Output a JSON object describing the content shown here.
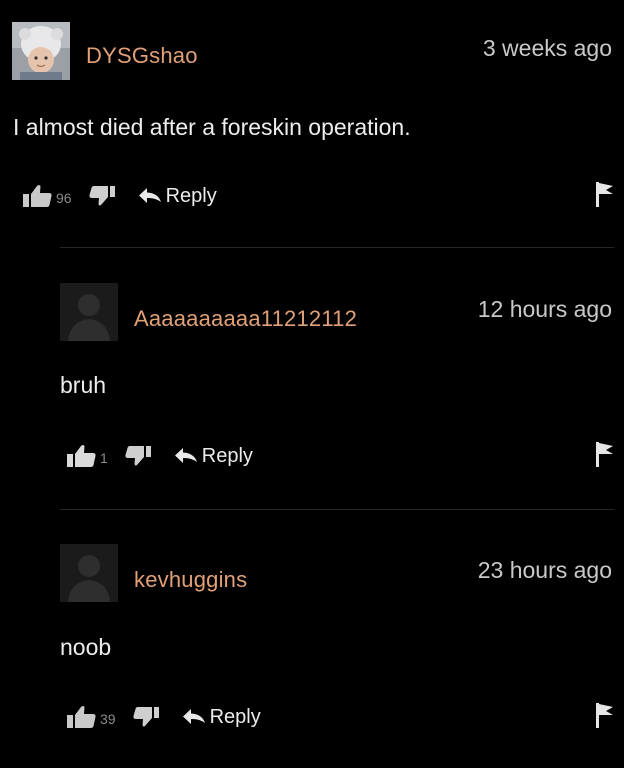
{
  "theme": {
    "username_color": "#e0a078",
    "background": "#000000"
  },
  "comments": [
    {
      "username": "DYSGshao",
      "timestamp": "3 weeks ago",
      "text": "I almost died after a foreskin operation.",
      "upvotes": "96",
      "reply_label": "Reply",
      "avatar": "user-photo-avatar"
    },
    {
      "username": "Aaaaaaaaaa11212112",
      "timestamp": "12 hours ago",
      "text": "bruh",
      "upvotes": "1",
      "reply_label": "Reply",
      "avatar": "default-silhouette-avatar"
    },
    {
      "username": "kevhuggins",
      "timestamp": "23 hours ago",
      "text": "noob",
      "upvotes": "39",
      "reply_label": "Reply",
      "avatar": "default-silhouette-avatar"
    }
  ],
  "icons": {
    "upvote": "thumbs-up-icon",
    "downvote": "thumbs-down-icon",
    "reply": "reply-arrow-icon",
    "flag": "flag-icon"
  }
}
